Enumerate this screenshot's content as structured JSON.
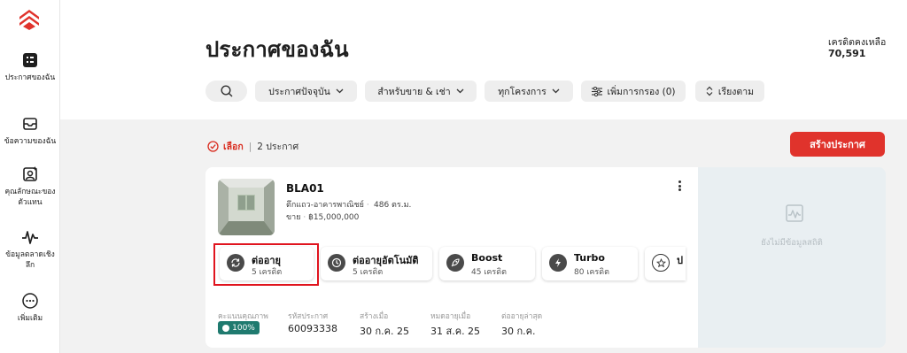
{
  "sidebar": {
    "items": [
      {
        "label": "ประกาศของฉัน"
      },
      {
        "label": "ข้อความของฉัน"
      },
      {
        "label": "คุณลักษณะของตัวแทน"
      },
      {
        "label": "ข้อมูลตลาดเชิงลึก"
      },
      {
        "label": "เพิ่มเติม"
      }
    ]
  },
  "header": {
    "title": "ประกาศของฉัน",
    "credit_label": "เครดิตคงเหลือ",
    "credit_value": "70,591"
  },
  "filters": {
    "items": [
      {
        "label": "ประกาศปัจจุบัน"
      },
      {
        "label": "สำหรับขาย & เช่า"
      },
      {
        "label": "ทุกโครงการ"
      },
      {
        "label": "เพิ่มการกรอง (0)"
      },
      {
        "label": "เรียงตาม"
      }
    ]
  },
  "list": {
    "select_label": "เลือก",
    "count_label": "2 ประกาศ",
    "create_button": "สร้างประกาศ"
  },
  "listing": {
    "name": "BLA01",
    "type": "ตึกแถว-อาคารพาณิชย์",
    "size": "486 ตร.ม.",
    "sale_label": "ขาย",
    "price": "฿15,000,000",
    "actions": [
      {
        "name": "ต่ออายุ",
        "credit": "5 เครดิต"
      },
      {
        "name": "ต่ออายุอัตโนมัติ",
        "credit": "5 เครดิต"
      },
      {
        "name": "Boost",
        "credit": "45 เครดิต"
      },
      {
        "name": "Turbo",
        "credit": "80 เครดิต"
      },
      {
        "name": "ป",
        "credit": ""
      }
    ],
    "meta": [
      {
        "label": "คะแนนคุณภาพ",
        "value": "100%"
      },
      {
        "label": "รหัสประกาศ",
        "value": "60093338"
      },
      {
        "label": "สร้างเมื่อ",
        "value": "30 ก.ค. 25"
      },
      {
        "label": "หมดอายุเมื่อ",
        "value": "31 ส.ค. 25"
      },
      {
        "label": "ต่ออายุล่าสุด",
        "value": "30 ก.ค."
      }
    ],
    "no_stats": "ยังไม่มีข้อมูลสถิติ"
  },
  "colors": {
    "accent": "#e0332c",
    "quality_badge": "#1f7a6f",
    "highlight_border": "#e0141e"
  }
}
